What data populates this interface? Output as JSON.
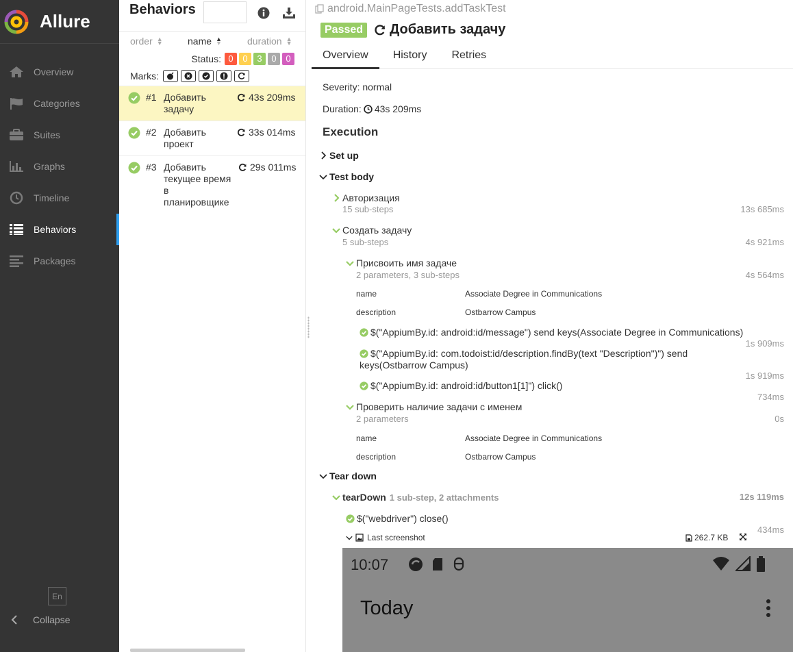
{
  "sidebar": {
    "app_name": "Allure",
    "items": [
      {
        "label": "Overview",
        "icon": "home-icon"
      },
      {
        "label": "Categories",
        "icon": "flag-icon"
      },
      {
        "label": "Suites",
        "icon": "briefcase-icon"
      },
      {
        "label": "Graphs",
        "icon": "bar-chart-icon"
      },
      {
        "label": "Timeline",
        "icon": "clock-icon"
      },
      {
        "label": "Behaviors",
        "icon": "list-icon",
        "active": true
      },
      {
        "label": "Packages",
        "icon": "align-left-icon"
      }
    ],
    "language": "En",
    "collapse_label": "Collapse",
    "accent_color": "#2f9ff0"
  },
  "tree": {
    "title": "Behaviors",
    "search_value": "",
    "sort": {
      "order": "order",
      "name": "name",
      "duration": "duration"
    },
    "status_label": "Status:",
    "status_counts": [
      {
        "value": "0",
        "color": "#fd5a3e"
      },
      {
        "value": "0",
        "color": "#ffd050"
      },
      {
        "value": "3",
        "color": "#97cc64"
      },
      {
        "value": "0",
        "color": "#aaaaaa"
      },
      {
        "value": "0",
        "color": "#d35ebe"
      }
    ],
    "marks_label": "Marks:",
    "rows": [
      {
        "num": "#1",
        "name": "Добавить задачу",
        "duration": "43s 209ms",
        "selected": true
      },
      {
        "num": "#2",
        "name": "Добавить проект",
        "duration": "33s 014ms"
      },
      {
        "num": "#3",
        "name": "Добавить текущее время в планировщике",
        "duration": "29s 011ms"
      }
    ]
  },
  "detail": {
    "breadcrumb": "android.MainPageTests.addTaskTest",
    "status": "Passed",
    "title": "Добавить задачу",
    "tabs": [
      "Overview",
      "History",
      "Retries"
    ],
    "severity": "Severity: normal",
    "duration_label": "Duration:",
    "duration_value": "43s 209ms",
    "execution_heading": "Execution",
    "setup": "Set up",
    "test_body": "Test body",
    "steps": {
      "auth": {
        "name": "Авторизация",
        "sub": "15 sub-steps",
        "time": "13s 685ms"
      },
      "create": {
        "name": "Создать задачу",
        "sub": "5 sub-steps",
        "time": "4s 921ms"
      },
      "assign": {
        "name": "Присвоить имя задаче",
        "sub": "2 parameters, 3 sub-steps",
        "time": "4s 564ms"
      },
      "assign_params": [
        {
          "key": "name",
          "value": "Associate Degree in Communications"
        },
        {
          "key": "description",
          "value": "Ostbarrow Campus"
        }
      ],
      "leaf1": {
        "text": "$(\"AppiumBy.id: android:id/message\") send keys(Associate Degree in Communications)",
        "time": "1s 909ms"
      },
      "leaf2": {
        "text": "$(\"AppiumBy.id: com.todoist:id/description.findBy(text \"Description\")\") send keys(Ostbarrow Campus)",
        "time": "1s 919ms"
      },
      "leaf3": {
        "text": "$(\"AppiumBy.id: android:id/button1[1]\") click()",
        "time": "734ms"
      },
      "check": {
        "name": "Проверить наличие задачи с именем",
        "sub": "2 parameters",
        "time": "0s"
      },
      "check_params": [
        {
          "key": "name",
          "value": "Associate Degree in Communications"
        },
        {
          "key": "description",
          "value": "Ostbarrow Campus"
        }
      ]
    },
    "teardown": "Tear down",
    "teardown_step": {
      "name": "tearDown",
      "meta": "1 sub-step, 2 attachments",
      "time": "12s 119ms"
    },
    "close_step": {
      "text": "$(\"webdriver\") close()",
      "time": "434ms"
    },
    "attachment": {
      "name": "Last screenshot",
      "size": "262.7 KB"
    },
    "screenshot": {
      "time": "10:07",
      "heading": "Today"
    }
  }
}
